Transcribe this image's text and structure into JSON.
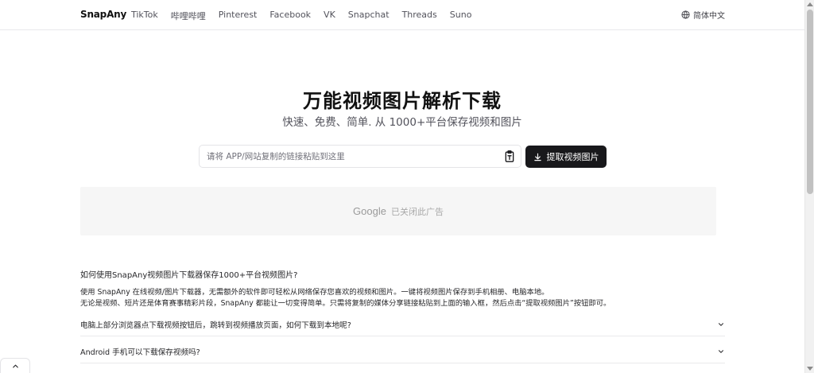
{
  "header": {
    "logo": "SnapAny",
    "nav": [
      "TikTok",
      "哔哩哔哩",
      "Pinterest",
      "Facebook",
      "VK",
      "Snapchat",
      "Threads",
      "Suno"
    ],
    "lang_label": "简体中文",
    "lang_icon": "globe-icon"
  },
  "hero": {
    "title": "万能视频图片解析下载",
    "subtitle": "快速、免费、简单. 从 1000+平台保存视频和图片"
  },
  "search": {
    "placeholder": "请将 APP/网站复制的链接粘贴到这里",
    "value": "",
    "paste_icon": "clipboard-paste-icon"
  },
  "extract_button": {
    "label": "提取视频图片",
    "icon": "download-icon"
  },
  "ad": {
    "brand": "Google",
    "text": "已关闭此广告"
  },
  "faq": {
    "question": "如何使用SnapAny视频图片下载器保存1000+平台视频图片?",
    "answer_line1": "使用 SnapAny 在线视频/图片下载器，无需额外的软件即可轻松从网络保存您喜欢的视频和图片。一键将视频图片保存到手机相册、电脑本地。",
    "answer_line2": "无论是视频、短片还是体育赛事精彩片段，SnapAny 都能让一切变得简单。只需将复制的媒体分享链接粘贴到上面的输入框，然后点击“提取视频图片”按钮即可。",
    "items": [
      {
        "question": "电脑上部分浏览器点下载视频按钮后，跳转到视频播放页面，如何下载到本地呢?"
      },
      {
        "question": "Android 手机可以下载保存视频吗?"
      }
    ]
  },
  "colors": {
    "button_bg": "#18181b",
    "ad_bg": "#f6f6f6",
    "text": "#27272a"
  }
}
